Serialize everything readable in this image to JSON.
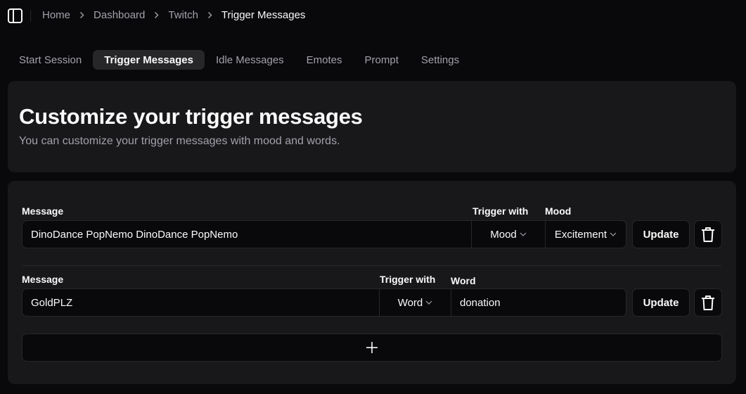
{
  "header": {
    "sidebar_toggle_icon": "panel-left-icon",
    "breadcrumb": [
      {
        "label": "Home"
      },
      {
        "label": "Dashboard"
      },
      {
        "label": "Twitch"
      },
      {
        "label": "Trigger Messages"
      }
    ]
  },
  "tabs": [
    {
      "label": "Start Session",
      "active": false
    },
    {
      "label": "Trigger Messages",
      "active": true
    },
    {
      "label": "Idle Messages",
      "active": false
    },
    {
      "label": "Emotes",
      "active": false
    },
    {
      "label": "Prompt",
      "active": false
    },
    {
      "label": "Settings",
      "active": false
    }
  ],
  "intro": {
    "title": "Customize your trigger messages",
    "subtitle": "You can customize your trigger messages with mood and words."
  },
  "messages": [
    {
      "message_label": "Message",
      "message_value": "DinoDance PopNemo DinoDance PopNemo",
      "trigger_label": "Trigger with",
      "trigger_value": "Mood",
      "param_label": "Mood",
      "param_value": "Excitement",
      "update_label": "Update",
      "delete_icon": "trash-icon"
    },
    {
      "message_label": "Message",
      "message_value": "GoldPLZ",
      "trigger_label": "Trigger with",
      "trigger_value": "Word",
      "param_label": "Word",
      "param_value": "donation",
      "update_label": "Update",
      "delete_icon": "trash-icon"
    }
  ],
  "add_button": {
    "icon": "plus-icon"
  },
  "colors": {
    "background": "#09090b",
    "card": "#18181b",
    "border": "#27272a",
    "text": "#fafafa",
    "muted": "#a1a1aa"
  }
}
